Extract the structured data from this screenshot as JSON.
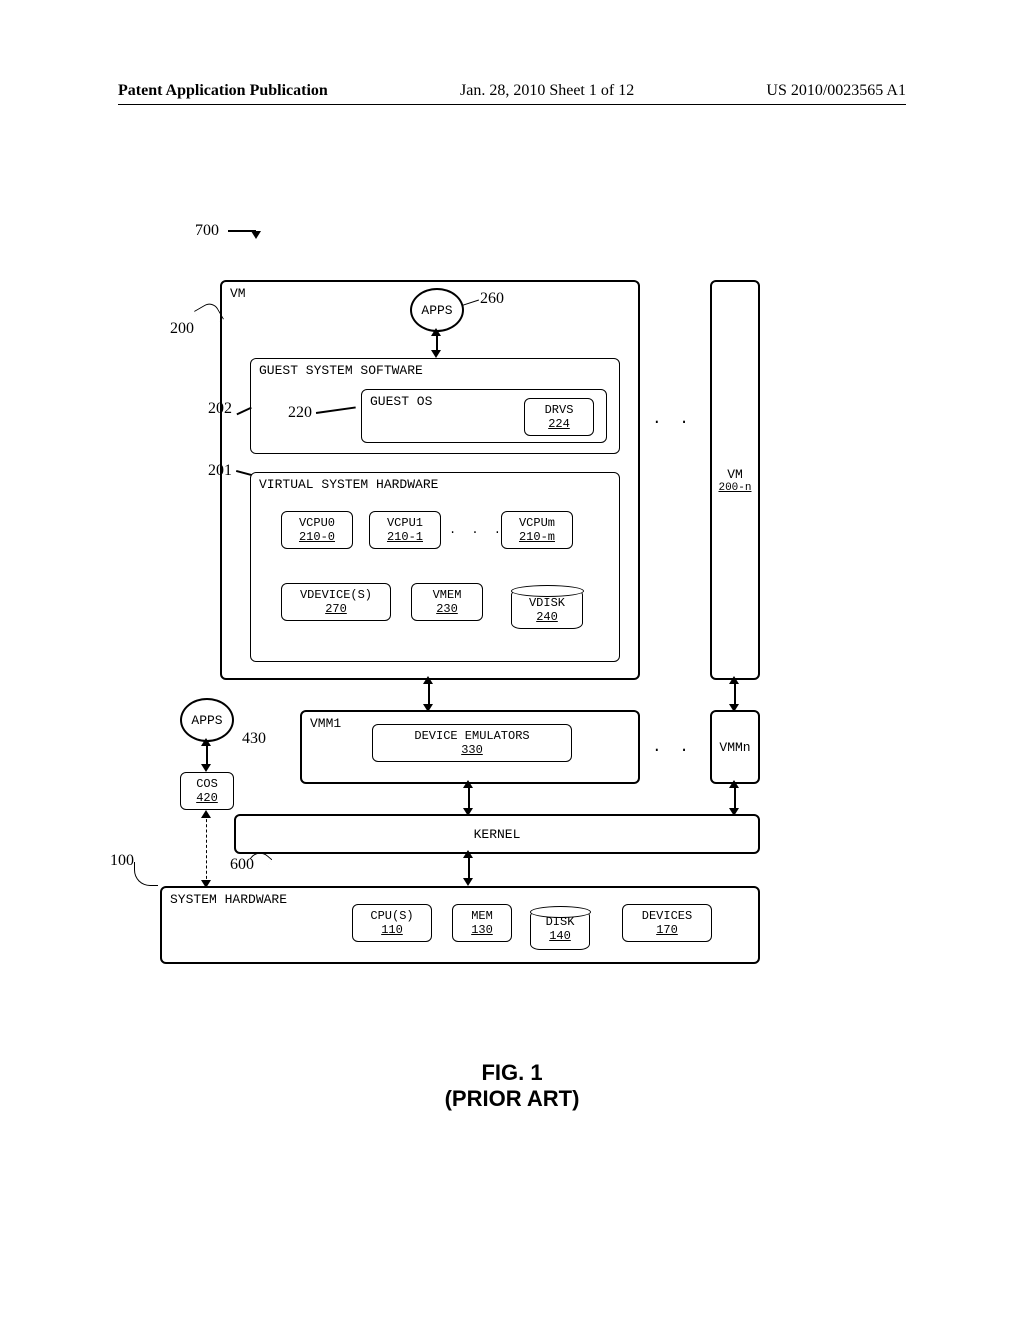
{
  "header": {
    "left": "Patent Application Publication",
    "mid": "Jan. 28, 2010  Sheet 1 of 12",
    "right": "US 2010/0023565 A1"
  },
  "refs": {
    "r700": "700",
    "r200": "200",
    "r260": "260",
    "r202": "202",
    "r220": "220",
    "r201": "201",
    "r430": "430",
    "r600": "600",
    "r100": "100"
  },
  "labels": {
    "vm": "VM",
    "apps": "APPS",
    "guest_sys_sw": "GUEST SYSTEM SOFTWARE",
    "guest_os": "GUEST OS",
    "drvs": "DRVS",
    "drvs_num": "224",
    "virt_sys_hw": "VIRTUAL SYSTEM HARDWARE",
    "vcpu0": "VCPU0",
    "vcpu0_num": "210-0",
    "vcpu1": "VCPU1",
    "vcpu1_num": "210-1",
    "vcpum": "VCPUm",
    "vcpum_num": "210-m",
    "vdevices": "VDEVICE(S)",
    "vdevices_num": "270",
    "vmem": "VMEM",
    "vmem_num": "230",
    "vdisk": "VDISK",
    "vdisk_num": "240",
    "vm_n": "VM",
    "vm_n_num": "200-n",
    "vmm1": "VMM1",
    "device_emulators": "DEVICE EMULATORS",
    "device_emulators_num": "330",
    "vmmn": "VMMn",
    "cos": "COS",
    "cos_num": "420",
    "kernel": "KERNEL",
    "sys_hw": "SYSTEM HARDWARE",
    "cpus": "CPU(S)",
    "cpus_num": "110",
    "mem": "MEM",
    "mem_num": "130",
    "disk": "DISK",
    "disk_num": "140",
    "devices": "DEVICES",
    "devices_num": "170",
    "dots": ". . ."
  },
  "caption": {
    "line1": "FIG. 1",
    "line2": "(PRIOR ART)"
  }
}
